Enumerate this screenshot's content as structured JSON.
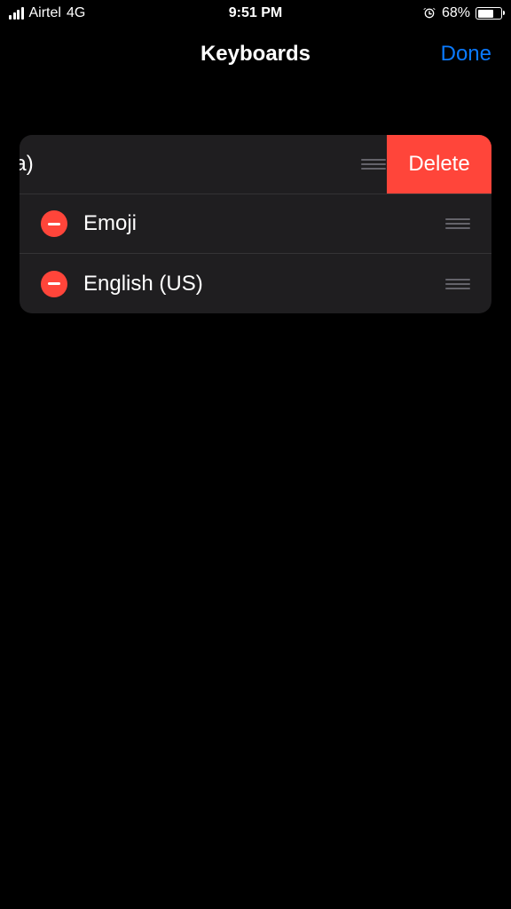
{
  "status": {
    "carrier": "Airtel",
    "net": "4G",
    "time": "9:51 PM",
    "battery_pct": "68%"
  },
  "nav": {
    "title": "Keyboards",
    "done": "Done"
  },
  "list": {
    "swiped_item": {
      "label_visible": "lish (India)",
      "delete": "Delete"
    },
    "items": [
      {
        "label": "Emoji"
      },
      {
        "label": "English (US)"
      }
    ]
  }
}
